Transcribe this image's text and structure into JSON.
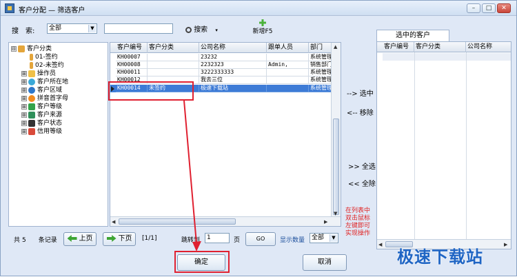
{
  "window": {
    "title": "客户分配 — 筛选客户",
    "min_glyph": "–",
    "max_glyph": "□",
    "close_glyph": "✕"
  },
  "toolbar": {
    "search_label": "搜　索:",
    "search_scope": "全部",
    "search_text": "",
    "search_button": "搜索",
    "add_button": "新增F5"
  },
  "tree": {
    "items": [
      {
        "label": "客户分类",
        "toggle": "⊟"
      },
      {
        "label": "01-签约",
        "toggle": ""
      },
      {
        "label": "02-未签约",
        "toggle": ""
      },
      {
        "label": "操作员",
        "toggle": "⊞"
      },
      {
        "label": "客户所在地",
        "toggle": "⊞"
      },
      {
        "label": "客户区域",
        "toggle": "⊞"
      },
      {
        "label": "拼音首字母",
        "toggle": "⊞"
      },
      {
        "label": "客户等级",
        "toggle": "⊞"
      },
      {
        "label": "客户来源",
        "toggle": "⊞"
      },
      {
        "label": "客户状态",
        "toggle": "⊞"
      },
      {
        "label": "信用等级",
        "toggle": "⊞"
      }
    ]
  },
  "grid": {
    "columns": [
      "客户编号",
      "客户分类",
      "公司名称",
      "跟单人员",
      "部门"
    ],
    "rows": [
      {
        "id": "KH00007",
        "category": "",
        "company": "23232",
        "staff": "",
        "dept": "系统管理"
      },
      {
        "id": "KH00008",
        "category": "",
        "company": "2232323",
        "staff": "Admin,",
        "dept": "销售部门"
      },
      {
        "id": "KH00011",
        "category": "",
        "company": "3222333333",
        "staff": "",
        "dept": "系统管理"
      },
      {
        "id": "KH00012",
        "category": "",
        "company": "我去三位",
        "staff": "",
        "dept": "系统管理"
      },
      {
        "id": "KH00014",
        "category": "未签约",
        "company": "极速下载站",
        "staff": "",
        "dept": "系统管理"
      }
    ]
  },
  "middle": {
    "select_one": "--> 选中",
    "remove_one": "<-- 移除",
    "select_all": ">> 全选",
    "remove_all": "<< 全除",
    "hint": "在列表中双击鼠标左键即可实现操作"
  },
  "right": {
    "tab": "选中的客户",
    "columns": [
      "客户编号",
      "客户分类",
      "公司名称"
    ]
  },
  "pager": {
    "total_prefix": "共",
    "total_count": "5",
    "total_suffix": "条记录",
    "prev": "上页",
    "next": "下页",
    "page_info": "[1/1]",
    "jump_label": "跳转到",
    "jump_value": "1",
    "page_unit": "页",
    "go": "GO",
    "display_label": "显示数量",
    "display_value": "全部"
  },
  "footer": {
    "confirm": "确定",
    "cancel": "取消"
  },
  "watermark": "极速下载站",
  "colors": {
    "selection": "#3d7bd6",
    "highlight_box": "#e02030",
    "hint_text": "#e02020",
    "watermark": "#1f65c4"
  }
}
